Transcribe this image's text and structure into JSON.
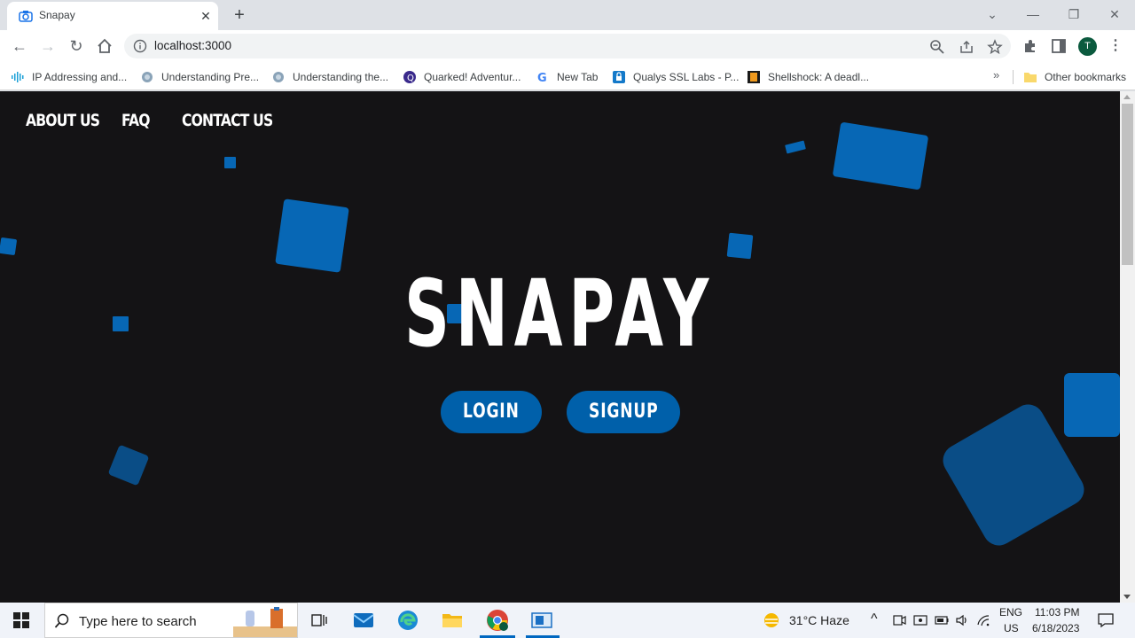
{
  "browser": {
    "tab_title": "Snapay",
    "url": "localhost:3000",
    "avatar_letter": "T",
    "bookmarks": [
      {
        "label": "IP Addressing and...",
        "icon": "cisco-icon"
      },
      {
        "label": "Understanding Pre...",
        "icon": "site-icon"
      },
      {
        "label": "Understanding the...",
        "icon": "site-icon"
      },
      {
        "label": "Quarked! Adventur...",
        "icon": "quarked-icon"
      },
      {
        "label": "New Tab",
        "icon": "google-icon"
      },
      {
        "label": "Qualys SSL Labs - P...",
        "icon": "lock-icon"
      },
      {
        "label": "Shellshock: A deadl...",
        "icon": "site-icon"
      }
    ],
    "bookmarks_more": "»",
    "other_bookmarks": "Other bookmarks"
  },
  "page": {
    "nav": [
      "ABOUT US",
      "FAQ",
      "CONTACT US"
    ],
    "hero_title": "SNAPAY",
    "login_label": "LOGIN",
    "signup_label": "SIGNUP",
    "accent_color": "#0767b5",
    "background_color": "#141315"
  },
  "taskbar": {
    "search_placeholder": "Type here to search",
    "weather": "31°C  Haze",
    "language": "ENG",
    "region": "US",
    "time": "11:03 PM",
    "date": "6/18/2023"
  }
}
